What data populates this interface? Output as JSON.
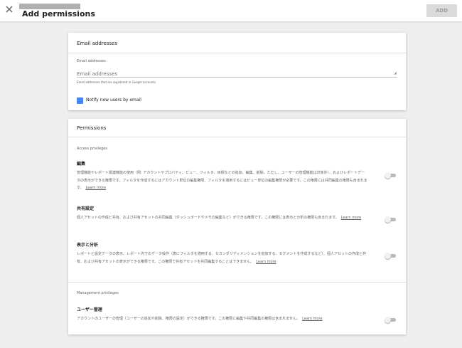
{
  "header": {
    "title": "Add permissions",
    "add_label": "ADD"
  },
  "email_card": {
    "heading": "Email addresses",
    "field_label": "Email addresses",
    "placeholder": "Email addresses",
    "help_text": "Email addresses that are registered in Google accounts",
    "notify_label": "Notify new users by email",
    "notify_checked": true
  },
  "permissions": {
    "heading": "Permissions",
    "access_label": "Access privileges",
    "learn_more": "Learn more",
    "items": [
      {
        "title": "編集",
        "desc": "管理機能やレポート関連機能の使用（例: アカウントやプロパティ、ビュー、フィルタ、目標などの追加、編集、削除。ただし、ユーザーの管理機能は対象外）、およびレポートデータの表示ができる権限です。フィルタを作成するにはアカウント単位の編集権限、フィルタを適用するにはビュー単位の編集権限が必要です。この権限には共同編集の権限も含まれます。",
        "enabled": false
      },
      {
        "title": "共有設定",
        "desc": "個人アセットの作成と共有、および共有アセットの共同編集（ダッシュボードやメモの編集など）ができる権限です。この権限には表示と分析の権限も含まれます。",
        "enabled": false
      },
      {
        "title": "表示と分析",
        "desc": "レポートと設定データの表示、レポート内でのデータ操作（表にフィルタを適用する、セカンダリディメンションを追加する、セグメントを作成するなど）、個人アセットの作成と共有、および共有アセットの表示ができる権限です。この権限で共有アセットを共同編集することはできません。",
        "enabled": false
      }
    ],
    "management_label": "Management privileges",
    "management_item": {
      "title": "ユーザー管理",
      "desc": "アカウントのユーザーの管理（ユーザーの追加や削除、権限の設定）ができる権限です。この権限に編集や共同編集の権限は含まれません。",
      "enabled": false
    }
  }
}
